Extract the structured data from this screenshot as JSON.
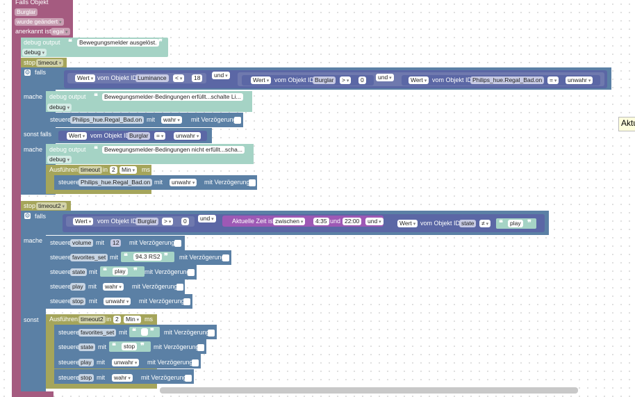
{
  "trigger": {
    "header": "Falls Objekt",
    "object_field": "Burglar",
    "change_field": "wurde geändert",
    "ack_label": "anerkannt ist",
    "ack_field": "egal"
  },
  "debug1": {
    "label": "debug output",
    "text": "Bewegungsmelder ausgelöst.",
    "level": "debug"
  },
  "stop1": {
    "label": "stop",
    "timer": "timeout"
  },
  "if1": {
    "label": "falls",
    "value_field": "Wert",
    "from_object_id": "vom Objekt ID",
    "obj_luminance": "Luminance",
    "op_lt": "<",
    "num_18": "18",
    "and_label": "und",
    "obj_burglar": "Burglar",
    "op_gt": ">",
    "num_0": "0",
    "obj_bad": "Philips_hue.Regal_Bad.on",
    "op_eq": "=",
    "bool_false": "unwahr"
  },
  "mache1": {
    "label": "mache",
    "debug_label": "debug output",
    "debug_text": "Bewegungsmelder-Bedingungen erfüllt...schalte Li...",
    "debug_level": "debug",
    "control_label": "steuere",
    "target": "Philips_hue.Regal_Bad.on",
    "with_label": "mit",
    "value": "wahr",
    "delay_label": "mit Verzögerung"
  },
  "elseif1": {
    "label": "sonst falls",
    "value_field": "Wert",
    "from_object_id": "vom Objekt ID",
    "obj": "Burglar",
    "op": "=",
    "value": "unwahr"
  },
  "mache2": {
    "label": "mache",
    "debug_label": "debug output",
    "debug_text": "Bewegungsmelder-Bedingungen nicht erfüllt...scha...",
    "debug_level": "debug",
    "run_label": "Ausführen",
    "timer": "timeout",
    "in_label": "in",
    "num": "2",
    "unit": "Min",
    "ms_label": "ms",
    "control_label": "steuere",
    "target": "Philips_hue.Regal_Bad.on",
    "with_label": "mit",
    "value": "unwahr",
    "delay_label": "mit Verzögerung"
  },
  "stop2": {
    "label": "stop",
    "timer": "timeout2"
  },
  "if2": {
    "label": "falls",
    "value_field": "Wert",
    "from_object_id": "vom Objekt ID",
    "obj": "Burglar",
    "op": ">",
    "num": "0",
    "and_label": "und",
    "time_label": "Aktuelle Zeit ist",
    "time_mode": "zwischen",
    "time_from": "4:35",
    "time_and": "und",
    "time_to": "22:00",
    "value_field2": "Wert",
    "obj2": "state",
    "op2": "≠",
    "text_value": "play"
  },
  "mache3": {
    "label": "mache",
    "control_label": "steuere",
    "with_label": "mit",
    "delay_label": "mit Verzögerung",
    "rows": [
      {
        "target": "volume",
        "value": "12"
      },
      {
        "target": "favorites_set",
        "value": "94.3 RS2"
      },
      {
        "target": "state",
        "value": "play"
      },
      {
        "target": "play",
        "value": "wahr"
      },
      {
        "target": "stop",
        "value": "unwahr"
      }
    ]
  },
  "else2": {
    "label": "sonst",
    "run_label": "Ausführen",
    "timer": "timeout2",
    "in_label": "in",
    "num": "2",
    "unit": "Min",
    "ms_label": "ms",
    "control_label": "steuere",
    "with_label": "mit",
    "delay_label": "mit Verzögerung",
    "rows": [
      {
        "target": "favorites_set",
        "value": ""
      },
      {
        "target": "state",
        "value": "stop"
      },
      {
        "target": "play",
        "value": "unwahr"
      },
      {
        "target": "stop",
        "value": "wahr"
      }
    ]
  },
  "tooltip": "Aktu",
  "colors": {
    "event": "#a55b80",
    "control": "#5b80a5",
    "logic": "#5b67a5",
    "text": "#a5d3c5",
    "timer": "#a5a55b"
  }
}
